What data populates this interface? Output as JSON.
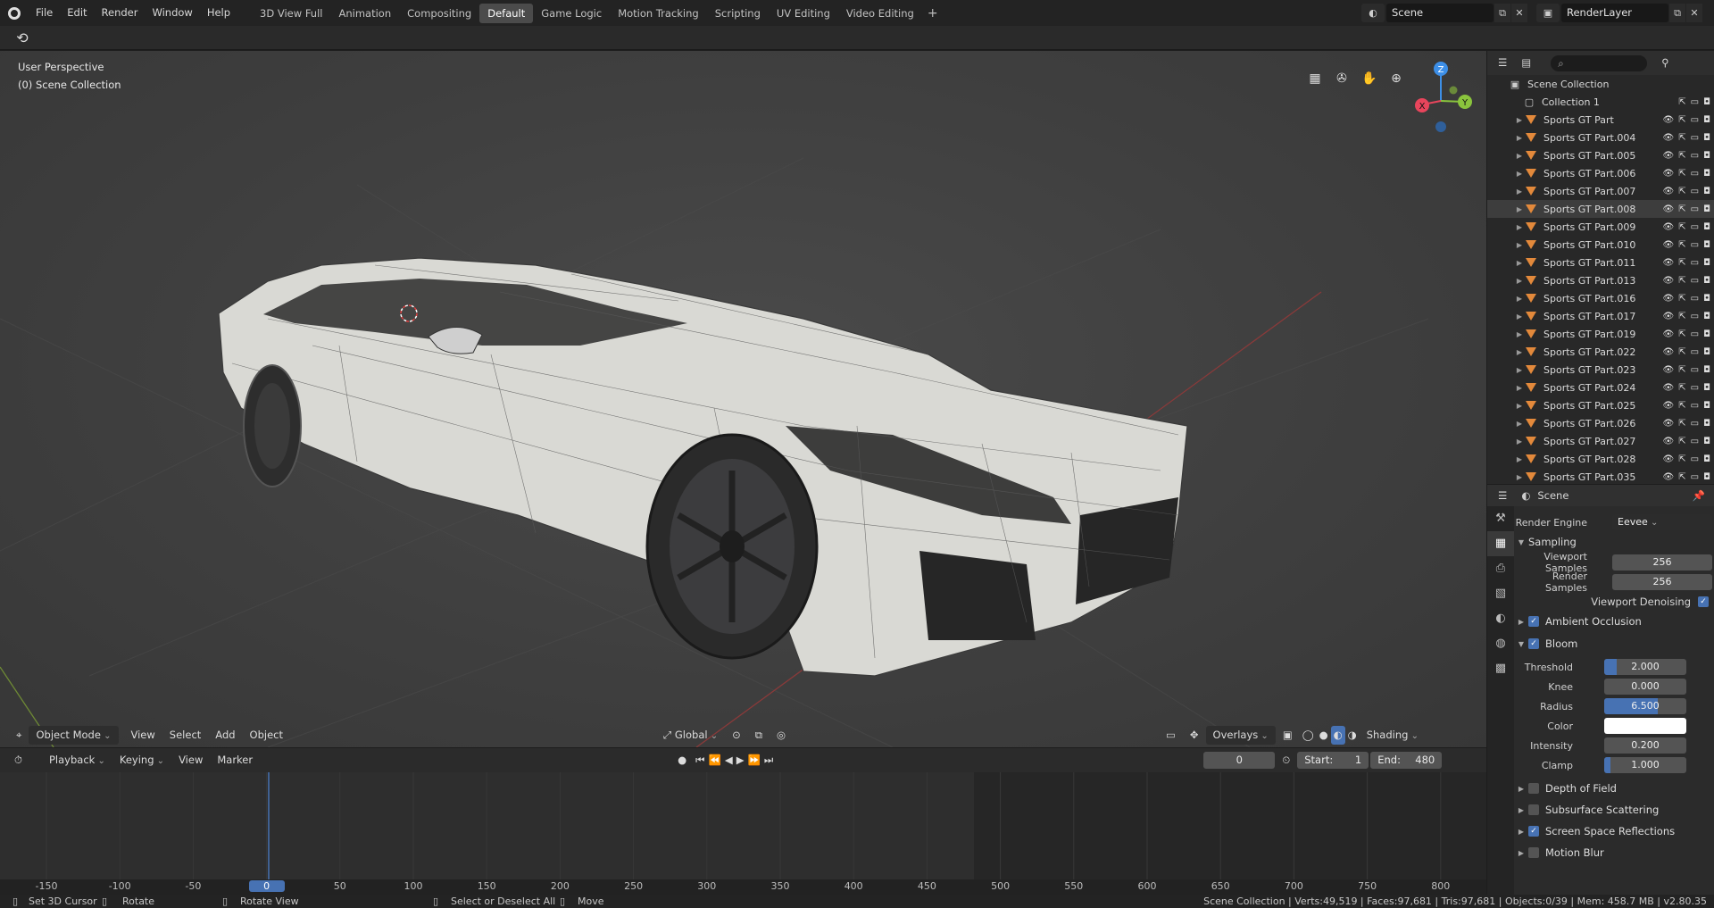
{
  "menu": [
    "File",
    "Edit",
    "Render",
    "Window",
    "Help"
  ],
  "workspaces": [
    "3D View Full",
    "Animation",
    "Compositing",
    "Default",
    "Game Logic",
    "Motion Tracking",
    "Scripting",
    "UV Editing",
    "Video Editing"
  ],
  "active_workspace": "Default",
  "add_workspace": "+",
  "scene_name": "Scene",
  "render_layer": "RenderLayer",
  "viewport": {
    "perspective": "User Perspective",
    "collection": "(0) Scene Collection",
    "gizmo_axes": {
      "z": "Z",
      "y": "Y",
      "x": "X"
    }
  },
  "viewport_header": {
    "mode": "Object Mode",
    "menus": [
      "View",
      "Select",
      "Add",
      "Object"
    ],
    "transform": "Global",
    "overlays": "Overlays",
    "shading": "Shading"
  },
  "timeline": {
    "menus": [
      "Playback",
      "Keying",
      "View",
      "Marker"
    ],
    "current_frame": "0",
    "start_label": "Start:",
    "start": "1",
    "end_label": "End:",
    "end": "480",
    "ruler": [
      "-150",
      "-100",
      "-50",
      "0",
      "50",
      "100",
      "150",
      "200",
      "250",
      "300",
      "350",
      "400",
      "450",
      "500",
      "550",
      "600",
      "650",
      "700",
      "750",
      "800"
    ]
  },
  "status": {
    "set_cursor": "Set 3D Cursor",
    "rotate": "Rotate",
    "rotate_view": "Rotate View",
    "select": "Select or Deselect All",
    "move": "Move",
    "stats": "Scene Collection | Verts:49,519 | Faces:97,681 | Tris:97,681 | Objects:0/39 | Mem: 458.7 MB | v2.80.35"
  },
  "outliner": {
    "root": "Scene Collection",
    "collection": "Collection 1",
    "items": [
      "Sports GT Part",
      "Sports GT Part.004",
      "Sports GT Part.005",
      "Sports GT Part.006",
      "Sports GT Part.007",
      "Sports GT Part.008",
      "Sports GT Part.009",
      "Sports GT Part.010",
      "Sports GT Part.011",
      "Sports GT Part.013",
      "Sports GT Part.016",
      "Sports GT Part.017",
      "Sports GT Part.019",
      "Sports GT Part.022",
      "Sports GT Part.023",
      "Sports GT Part.024",
      "Sports GT Part.025",
      "Sports GT Part.026",
      "Sports GT Part.027",
      "Sports GT Part.028",
      "Sports GT Part.035"
    ],
    "selected": "Sports GT Part.008"
  },
  "properties": {
    "context": "Scene",
    "render_engine_label": "Render Engine",
    "render_engine": "Eevee",
    "sampling": "Sampling",
    "viewport_samples_label": "Viewport Samples",
    "viewport_samples": "256",
    "render_samples_label": "Render Samples",
    "render_samples": "256",
    "viewport_denoising": "Viewport Denoising",
    "ambient_occlusion": "Ambient Occlusion",
    "bloom": "Bloom",
    "threshold_label": "Threshold",
    "threshold": "2.000",
    "knee_label": "Knee",
    "knee": "0.000",
    "radius_label": "Radius",
    "radius": "6.500",
    "color_label": "Color",
    "intensity_label": "Intensity",
    "intensity": "0.200",
    "clamp_label": "Clamp",
    "clamp": "1.000",
    "depth_of_field": "Depth of Field",
    "subsurface": "Subsurface Scattering",
    "ssr": "Screen Space Reflections",
    "motion_blur": "Motion Blur"
  },
  "colors": {
    "accent": "#4772b3",
    "selected_tab": "#4b4b4b",
    "object_icon": "#e3893b",
    "axis_x": "#e8455c",
    "axis_y": "#8ac43d",
    "axis_z": "#3d8fe8"
  }
}
